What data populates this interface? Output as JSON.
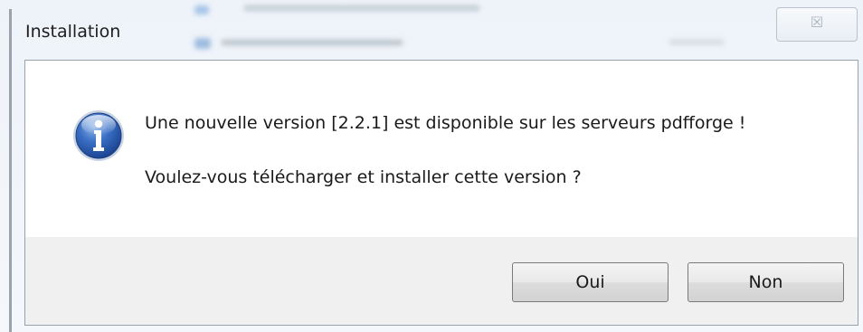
{
  "window": {
    "title": "Installation",
    "close_glyph": "☒"
  },
  "dialog": {
    "icon": "info-icon",
    "message_line1": "Une nouvelle version [2.2.1] est disponible sur les serveurs pdfforge !",
    "message_line2": "Voulez-vous télécharger et installer cette version ?"
  },
  "buttons": {
    "yes_label": "Oui",
    "no_label": "Non"
  },
  "colors": {
    "info_icon": "#2f62b8",
    "client_background": "#ffffff",
    "footer_background": "#f0f0f0"
  }
}
